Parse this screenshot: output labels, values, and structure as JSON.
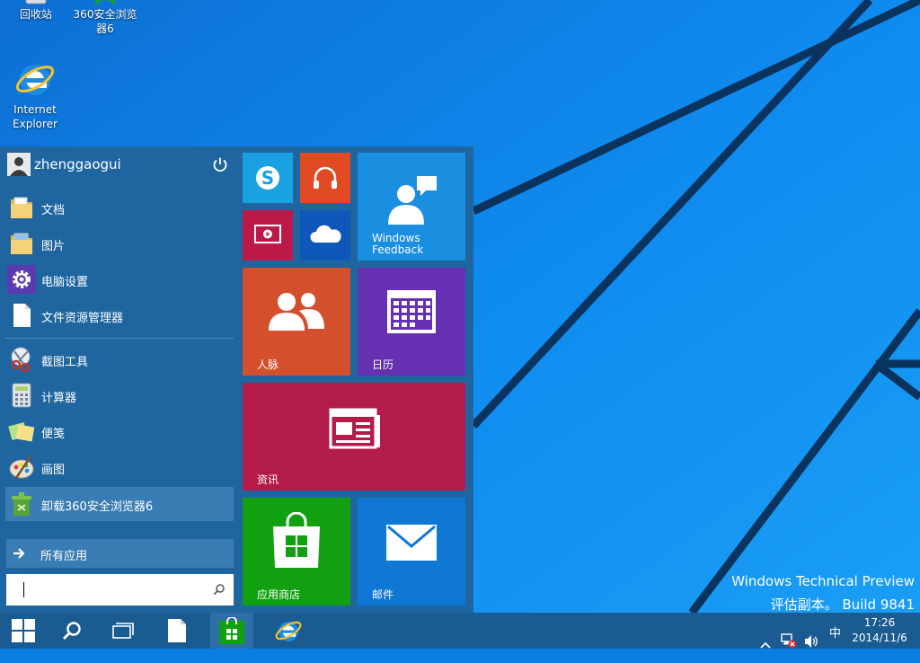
{
  "desktop": {
    "icons": [
      {
        "label": "回收站"
      },
      {
        "label_line1": "360安全浏览",
        "label_line2": "器6"
      },
      {
        "label_line1": "Internet",
        "label_line2": "Explorer"
      }
    ],
    "watermark": {
      "line1": "Windows Technical Preview",
      "line2": "评估副本。 Build 9841"
    }
  },
  "start_menu": {
    "user_name": "zhenggaogui",
    "places": [
      {
        "label": "文档",
        "icon": "folder-documents-icon"
      },
      {
        "label": "图片",
        "icon": "folder-pictures-icon"
      },
      {
        "label": "电脑设置",
        "icon": "gear-icon"
      },
      {
        "label": "文件资源管理器",
        "icon": "file-icon"
      }
    ],
    "apps": [
      {
        "label": "截图工具",
        "icon": "scissors-icon"
      },
      {
        "label": "计算器",
        "icon": "calculator-icon"
      },
      {
        "label": "便笺",
        "icon": "sticky-notes-icon"
      },
      {
        "label": "画图",
        "icon": "paint-palette-icon"
      },
      {
        "label": "卸载360安全浏览器6",
        "icon": "uninstall-icon",
        "highlighted": true
      }
    ],
    "all_apps_label": "所有应用",
    "search_value": "",
    "tiles": [
      {
        "name": "skype",
        "label": "",
        "color": "#1aa1e1"
      },
      {
        "name": "music",
        "label": "",
        "color": "#e14b24"
      },
      {
        "name": "video",
        "label": "",
        "color": "#bc1949"
      },
      {
        "name": "onedrive",
        "label": "",
        "color": "#0f57b8"
      },
      {
        "name": "windows-feedback",
        "label": "Windows\nFeedback",
        "color": "#1a8fe0"
      },
      {
        "name": "people",
        "label": "人脉",
        "color": "#d4502c"
      },
      {
        "name": "calendar",
        "label": "日历",
        "color": "#6530b2"
      },
      {
        "name": "news",
        "label": "资讯",
        "color": "#b31b4a"
      },
      {
        "name": "store",
        "label": "应用商店",
        "color": "#11a011"
      },
      {
        "name": "mail",
        "label": "邮件",
        "color": "#0f78d4"
      }
    ]
  },
  "taskbar": {
    "buttons": [
      "start-button",
      "search-button",
      "task-view-button",
      "file-explorer-button",
      "store-button",
      "internet-explorer-button"
    ],
    "tray": {
      "ime": "中"
    },
    "clock": {
      "time": "17:26",
      "date": "2014/11/6"
    }
  },
  "colors": {
    "start_bg": "#1f66a0",
    "taskbar_bg": "#1a5b92",
    "desktop_bg": "#0a7fe0"
  }
}
